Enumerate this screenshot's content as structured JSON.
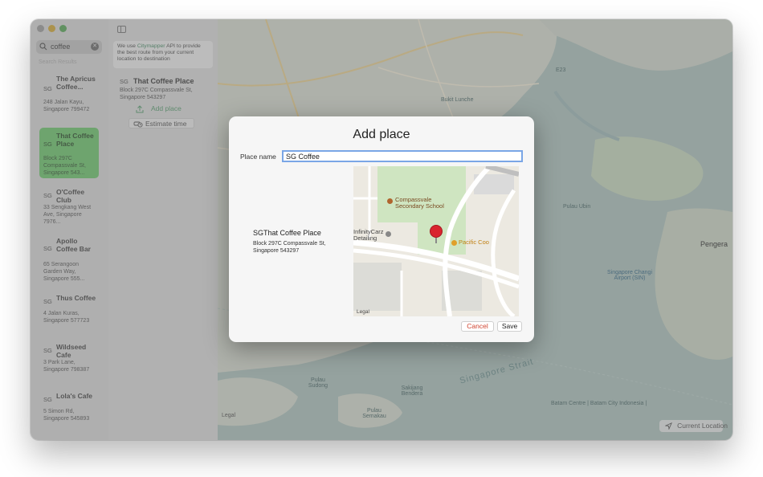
{
  "sidebar": {
    "search_value": "coffee",
    "results_header": "Search Results",
    "results": [
      {
        "code": "SG",
        "title": "The Apricus Coffee...",
        "address": "248 Jalan Kayu, Singapore 799472",
        "selected": false
      },
      {
        "code": "SG",
        "title": "That Coffee Place",
        "address": "Block 297C Compassvale St, Singapore 543...",
        "selected": true
      },
      {
        "code": "SG",
        "title": "O'Coffee Club",
        "address": "33 Sengkang West Ave, Singapore 7976...",
        "selected": false
      },
      {
        "code": "SG",
        "title": "Apollo Coffee Bar",
        "address": "65 Serangoon Garden Way, Singapore 555...",
        "selected": false
      },
      {
        "code": "SG",
        "title": "Thus Coffee",
        "address": "4 Jalan Kuras, Singapore 577723",
        "selected": false
      },
      {
        "code": "SG",
        "title": "Wildseed Cafe",
        "address": "3 Park Lane, Singapore 798387",
        "selected": false
      },
      {
        "code": "SG",
        "title": "Lola's Cafe",
        "address": "5 Simon Rd, Singapore 545893",
        "selected": false
      }
    ]
  },
  "middle": {
    "info_prefix": "We use ",
    "info_link": "Citymapper",
    "info_suffix": " API to provide the best route from your current location to destination",
    "detail_code": "SG",
    "detail_name": "That Coffee Place",
    "detail_address": "Block 297C Compassvale St, Singapore 543297",
    "add_place_label": "Add place",
    "estimate_label": "Estimate time"
  },
  "map": {
    "labels": {
      "bukit_lunche": "Bukit Lunche",
      "pulau_ubin": "Pulau Ubin",
      "pengerang": "Pengera",
      "changi_airport": "Singapore Changi Airport (SIN)",
      "singapore_strait": "Singapore Strait",
      "batam_centre": "Batam Centre | Batam City Indonesia |",
      "pulau_semakau": "Pulau Semakau",
      "sakijang": "Sakijang Bendera",
      "pulau_sudong": "Pulau Sudong",
      "legal": "Legal",
      "road_e23": "E23"
    },
    "current_location_label": "Current Location"
  },
  "modal": {
    "title": "Add place",
    "name_label": "Place name",
    "name_value": "SG Coffee",
    "place_title": "SGThat Coffee Place",
    "place_address": "Block 297C Compassvale St, Singapore 543297",
    "mini_map": {
      "school": "Compassvale Secondary School",
      "carz": "InfinityCarz Detailing",
      "pacific": "Pacific Coo",
      "legal": "Legal"
    },
    "cancel_label": "Cancel",
    "save_label": "Save"
  },
  "colors": {
    "selected_result": "#6ec06e",
    "link": "#4b8a67",
    "cancel": "#d0432f",
    "input_focus": "#7aa6e6"
  }
}
